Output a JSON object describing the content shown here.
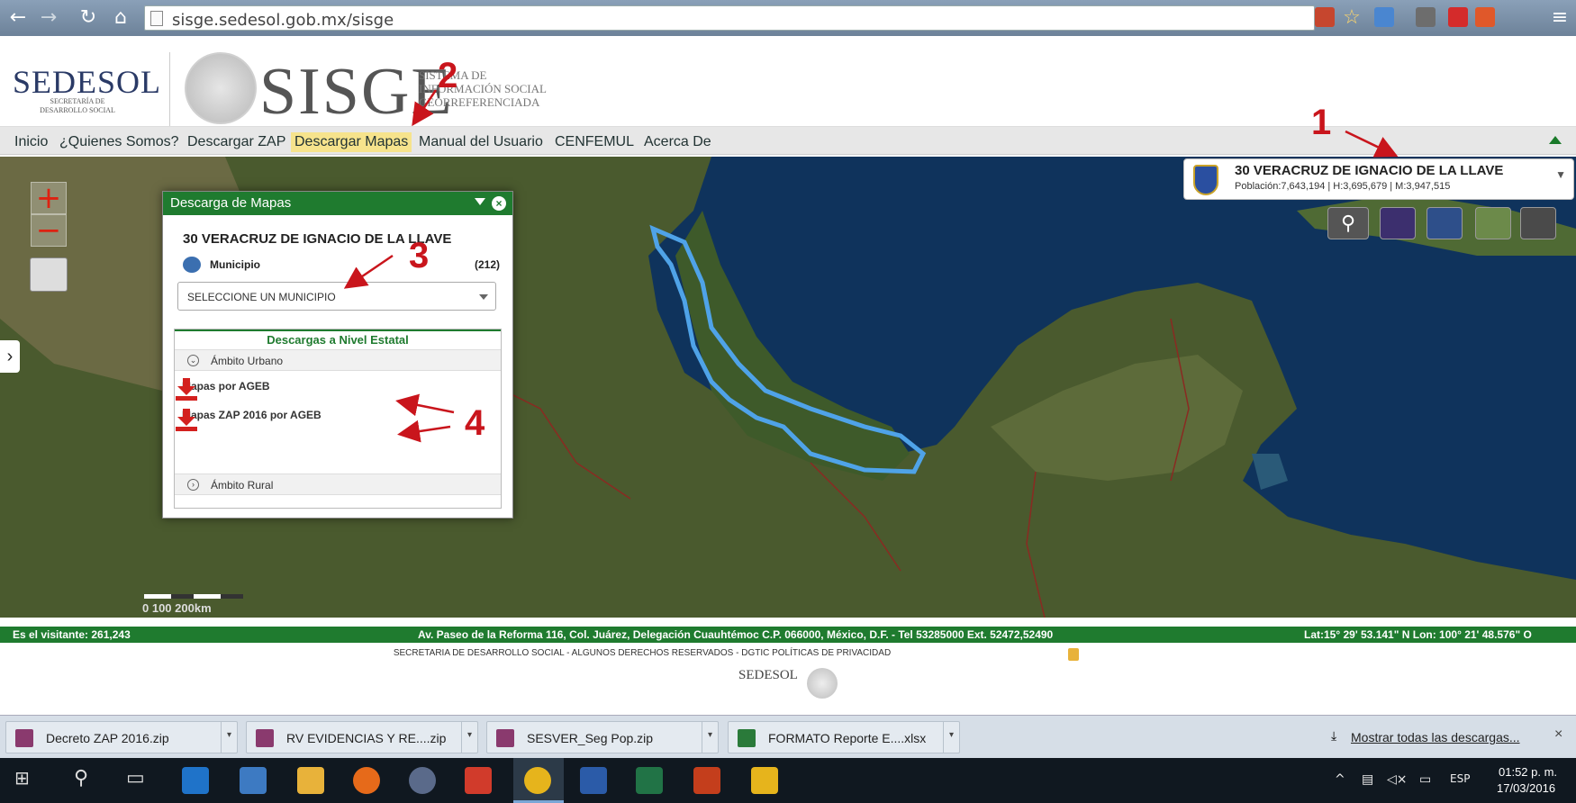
{
  "browser": {
    "url": "sisge.sedesol.gob.mx/sisge"
  },
  "header": {
    "sedesol_logo": "SEDESOL",
    "sedesol_sub": "SECRETARÍA DE DESARROLLO SOCIAL",
    "sisge_logo": "SISGE",
    "sisge_sub_1": "SISTEMA DE",
    "sisge_sub_2": "INFORMACIÓN SOCIAL",
    "sisge_sub_3": "GEORREFERENCIADA"
  },
  "menu": {
    "items": [
      "Inicio",
      "¿Quienes Somos?",
      "Descargar ZAP",
      "Descargar Mapas",
      "Manual del Usuario",
      "CENFEMUL",
      "Acerca De"
    ],
    "active": "Descargar Mapas"
  },
  "state_box": {
    "name": "30 VERACRUZ DE IGNACIO DE LA LLAVE",
    "stats": "Población:7,643,194     | H:3,695,679    | M:3,947,515"
  },
  "panel": {
    "title": "Descarga de Mapas",
    "state": "30 VERACRUZ DE IGNACIO DE LA LLAVE",
    "municipio_label": "Municipio",
    "municipio_count": "(212)",
    "select_value": "SELECCIONE UN MUNICIPIO",
    "estatal_title": "Descargas a Nivel Estatal",
    "urbano_label": "Ámbito Urbano",
    "rural_label": "Ámbito Rural",
    "downloads": [
      "Mapas por AGEB",
      "Mapas ZAP 2016 por AGEB"
    ]
  },
  "map": {
    "scale_text": "0      100    200km"
  },
  "annotations": [
    "1",
    "2",
    "3",
    "4"
  ],
  "footer": {
    "visitor": "Es el visitante: 261,243",
    "address": "Av. Paseo de la Reforma 116, Col. Juárez, Delegación Cuauhtémoc C.P. 066000, México, D.F. - Tel 53285000 Ext. 52472,52490",
    "latlon": "Lat:15° 29' 53.141\" N Lon: 100° 21' 48.576\" O",
    "rights": "SECRETARIA DE DESARROLLO SOCIAL - ALGUNOS DERECHOS RESERVADOS - DGTIC POLÍTICAS DE PRIVACIDAD",
    "logo": "SEDESOL"
  },
  "downloads_bar": {
    "files": [
      "Decreto ZAP 2016.zip",
      "RV EVIDENCIAS Y RE....zip",
      "SESVER_Seg Pop.zip",
      "FORMATO Reporte E....xlsx"
    ],
    "show_all": "Mostrar todas las descargas...",
    "close": "×"
  },
  "taskbar": {
    "lang": "ESP",
    "time": "01:52 p. m.",
    "date": "17/03/2016"
  },
  "colors": {
    "green": "#1f7b2f",
    "annotation_red": "#c9151c",
    "menu_active": "#f6e38c"
  }
}
